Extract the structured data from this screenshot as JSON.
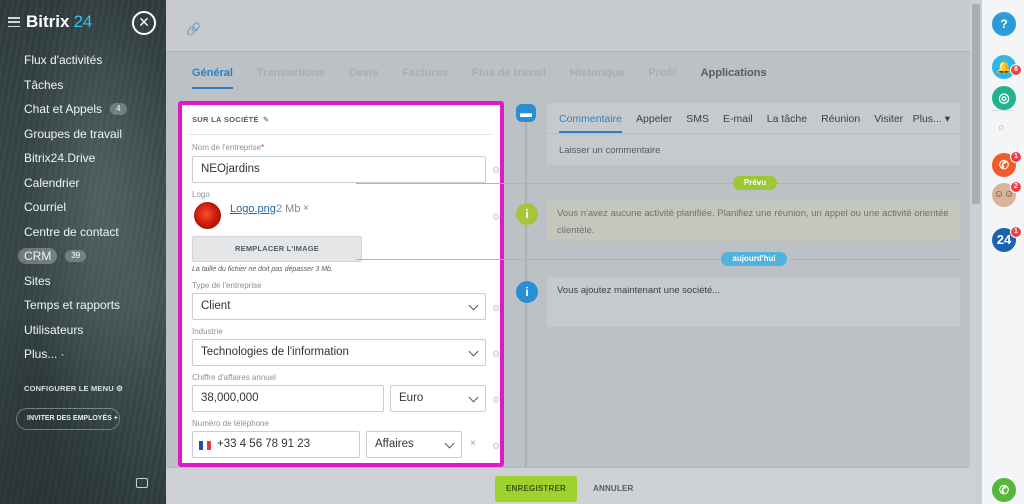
{
  "sidebar": {
    "logo": "Bitrix",
    "logo_num": "24",
    "items": [
      {
        "label": "Flux d'activités"
      },
      {
        "label": "Tâches"
      },
      {
        "label": "Chat et Appels",
        "badge": "4"
      },
      {
        "label": "Groupes de travail"
      },
      {
        "label": "Bitrix24.Drive"
      },
      {
        "label": "Calendrier"
      },
      {
        "label": "Courriel"
      },
      {
        "label": "Centre de contact"
      },
      {
        "label": "CRM",
        "badge": "39"
      },
      {
        "label": "Sites"
      },
      {
        "label": "Temps et rapports"
      },
      {
        "label": "Utilisateurs"
      },
      {
        "label": "Plus... ·"
      }
    ],
    "configure_menu": "CONFIGURER LE MENU",
    "invite": "INVITER DES EMPLOYÉS"
  },
  "tabs": [
    {
      "label": "Général"
    },
    {
      "label": "Transactions"
    },
    {
      "label": "Devis"
    },
    {
      "label": "Factures"
    },
    {
      "label": "Flux de travail"
    },
    {
      "label": "Historique"
    },
    {
      "label": "Profil"
    },
    {
      "label": "Applications"
    }
  ],
  "form": {
    "section_title": "SUR LA SOCIÉTÉ",
    "company_name_label": "Nom de l'entreprise",
    "company_name_value": "NEOjardins",
    "logo_label": "Logo",
    "logo_file": "Logo.png",
    "logo_size": "2 Mb",
    "replace_image": "REMPLACER L'IMAGE",
    "file_hint": "La taille du fichier ne doit pas dépasser 3 Mb.",
    "company_type_label": "Type de l'entreprise",
    "company_type_value": "Client",
    "industry_label": "Industrie",
    "industry_value": "Technologies de l'information",
    "revenue_label": "Chiffre d'affaires annuel",
    "revenue_value": "38,000,000",
    "currency_value": "Euro",
    "phone_label": "Numéro de téléphone",
    "phone_value": "+33 4 56 78 91 23",
    "phone_type_value": "Affaires"
  },
  "timeline": {
    "comment_tabs": [
      {
        "label": "Commentaire"
      },
      {
        "label": "Appeler"
      },
      {
        "label": "SMS"
      },
      {
        "label": "E-mail"
      },
      {
        "label": "La tâche"
      },
      {
        "label": "Réunion"
      },
      {
        "label": "Visiter"
      }
    ],
    "more": "Plus...",
    "comment_placeholder": "Laisser un commentaire",
    "planned_pill": "Prévu",
    "planned_text": "Vous n'avez aucune activité planifiée. Planifiez une réunion, un appel ou une activité orientée clientèle.",
    "today_pill": "aujourd'hui",
    "today_text": "Vous ajoutez maintenant une société..."
  },
  "bottom": {
    "save": "ENREGISTRER",
    "cancel": "ANNULER"
  },
  "rightbar": {
    "help": "?",
    "notif_badge": "8",
    "call_badge": "1",
    "users_badge": "2",
    "b24_label": "24",
    "b24_badge": "1"
  },
  "colors": {
    "accent": "#2c7fc5",
    "highlight_border": "#e019c8",
    "save_button": "#9fd22c",
    "planned_pill": "#9dc834",
    "today_pill": "#4fb3de"
  }
}
